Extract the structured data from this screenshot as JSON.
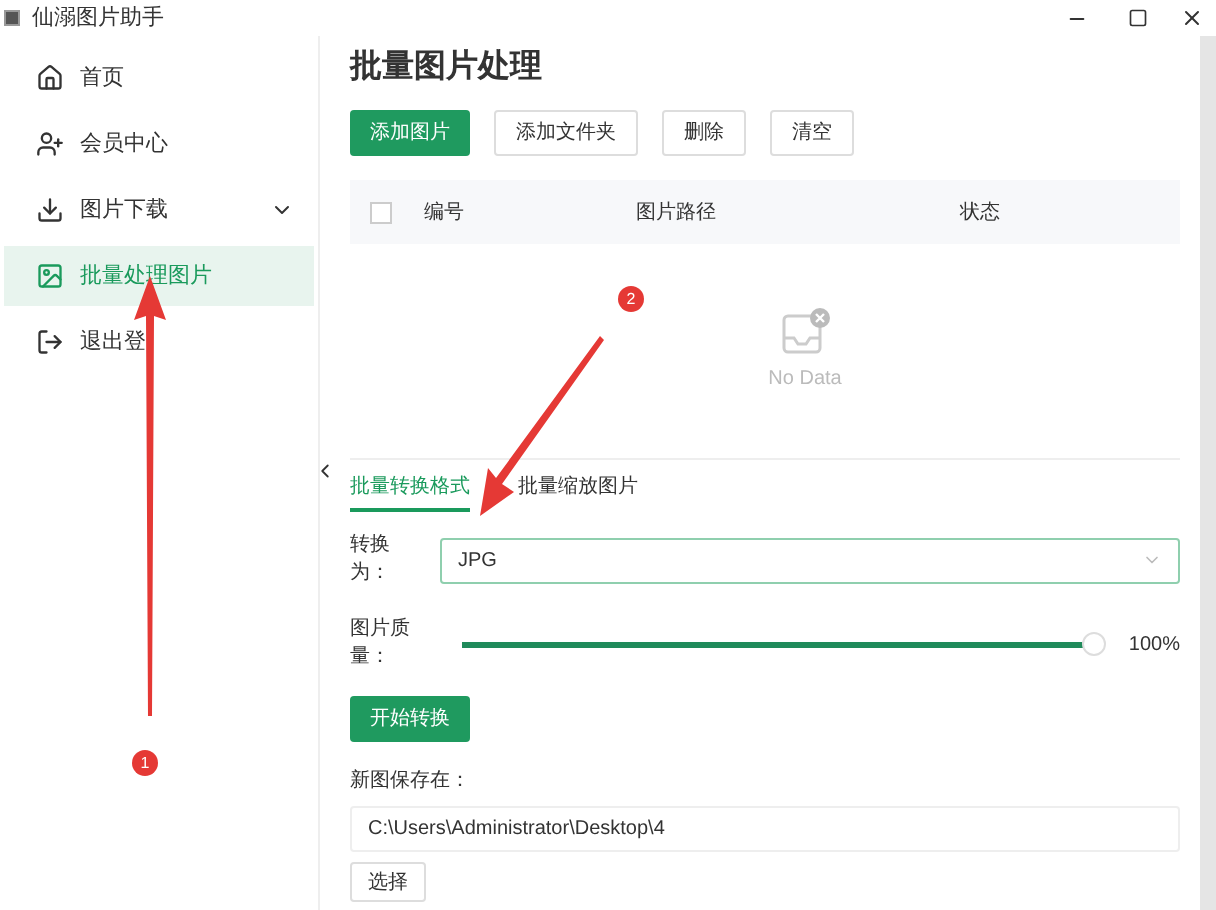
{
  "window": {
    "title": "仙溺图片助手"
  },
  "sidebar": {
    "items": [
      {
        "label": "首页",
        "selected": false
      },
      {
        "label": "会员中心",
        "selected": false
      },
      {
        "label": "图片下载",
        "selected": false,
        "expandable": true
      },
      {
        "label": "批量处理图片",
        "selected": true
      },
      {
        "label": "退出登",
        "selected": false
      }
    ]
  },
  "main": {
    "title": "批量图片处理",
    "toolbar": [
      {
        "label": "添加图片",
        "primary": true
      },
      {
        "label": "添加文件夹",
        "primary": false
      },
      {
        "label": "删除",
        "primary": false
      },
      {
        "label": "清空",
        "primary": false
      }
    ],
    "table": {
      "select_all_checked": false,
      "columns": [
        "编号",
        "图片路径",
        "状态"
      ],
      "empty_text": "No Data"
    },
    "tabs": [
      {
        "label": "批量转换格式",
        "selected": true
      },
      {
        "label": "批量缩放图片",
        "selected": false
      }
    ],
    "convert": {
      "label_line1": "转换",
      "label_line2": "为：",
      "value": "JPG"
    },
    "quality": {
      "label_line1": "图片质",
      "label_line2": "量：",
      "level": 1,
      "reading": "100%"
    },
    "start_button": "开始转换",
    "save": {
      "label": "新图保存在：",
      "value": "C:\\Users\\Administrator\\Desktop\\4",
      "button": "选择"
    }
  },
  "annotations": [
    {
      "number": "1"
    },
    {
      "number": "2"
    }
  ]
}
